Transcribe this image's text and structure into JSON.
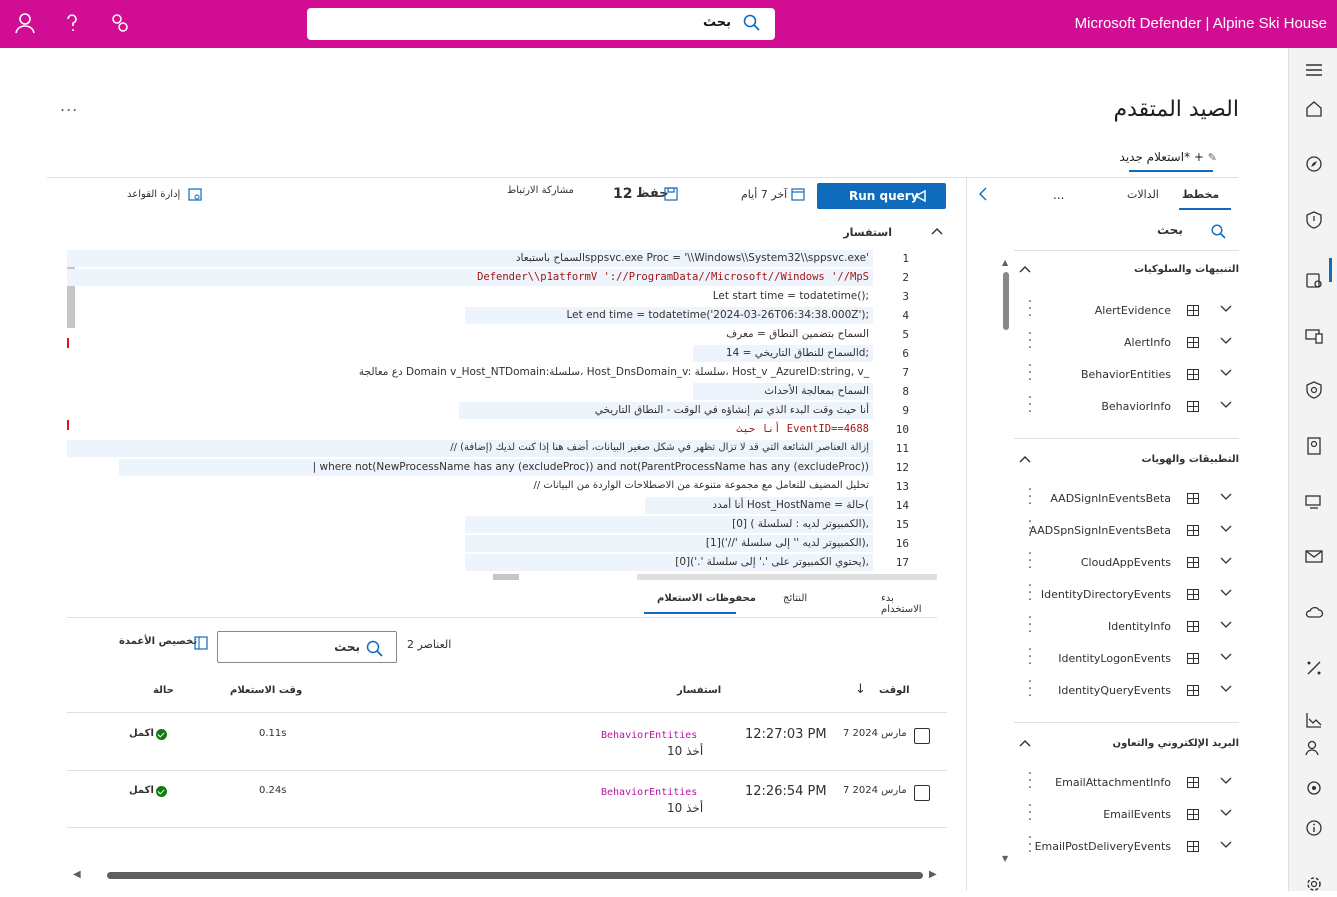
{
  "header": {
    "app_title": "Microsoft Defender | Alpine Ski House",
    "search_placeholder": "بحث"
  },
  "page": {
    "title": "الصيد المتقدم",
    "more": "...",
    "tab_label": "استعلام جديد* +"
  },
  "toolbar": {
    "run_label": "Run query",
    "time_range": "آخر 7 أيام",
    "save_label": "حفظ",
    "save_count": "12",
    "share_label": "مشاركة الارتباط",
    "rules_label": "إدارة القواعد"
  },
  "schema_panel": {
    "tabs": [
      "مخطط",
      "الدالات",
      "..."
    ],
    "search_label": "بحث",
    "groups": [
      {
        "title": "التنبيهات والسلوكيات",
        "tables": [
          "AlertEvidence",
          "AlertInfo",
          "BehaviorEntities",
          "BehaviorInfo"
        ]
      },
      {
        "title": "التطبيقات والهويات",
        "tables": [
          "AADSignInEventsBeta",
          "AADSpnSignInEventsBeta",
          "CloudAppEvents",
          "IdentityDirectoryEvents",
          "IdentityInfo",
          "IdentityLogonEvents",
          "IdentityQueryEvents"
        ]
      },
      {
        "title": "البريد الإلكتروني والتعاون",
        "tables": [
          "EmailAttachmentInfo",
          "EmailEvents",
          "EmailPostDeliveryEvents"
        ]
      }
    ]
  },
  "editor": {
    "label": "استفسار",
    "lines": [
      {
        "n": "1",
        "text": "السماح باستبعادsppsvc.exe Proc = '\\\\Windows\\\\System32\\\\sppsvc.exe'"
      },
      {
        "n": "2",
        "text": "Defender\\\\p1atformV '://ProgramData//Microsoft//Windows '//MpS"
      },
      {
        "n": "3",
        "text": "Let start time = todatetime();"
      },
      {
        "n": "4",
        "text": "Let end time = todatetime('2024-03-26T06:34:38.000Z');"
      },
      {
        "n": "5",
        "text": "السماح بتضمين النطاق = معرف"
      },
      {
        "n": "6",
        "text": "السماح للنطاق التاريخي = 14d;"
      },
      {
        "n": "7",
        "text": "دع معالجة Domain v_Host_NTDomain:سلسلة، Host_DnsDomain_v: سلسلة، Host_v _AzureID:string, v_"
      },
      {
        "n": "8",
        "text": "السماح بمعالجة الأحداث"
      },
      {
        "n": "9",
        "text": "أنا حيث وقت البدء الذي تم إنشاؤه في الوقت - النطاق التاريخي"
      },
      {
        "n": "10",
        "text": "أنا حيث EventID==4688"
      },
      {
        "n": "11",
        "text": "// إزالة العناصر الشائعة التي قد لا تزال تظهر في شكل صغير البيانات، أضف هنا إذا كنت لديك (إضافة)"
      },
      {
        "n": "12",
        "text": "| where not(NewProcessName has any (excludeProc)) and not(ParentProcessName has any (excludeProc))"
      },
      {
        "n": "13",
        "text": "// تحليل المضيف للتعامل مع مجموعة متنوعة من الاصطلاحات الواردة من البيانات"
      },
      {
        "n": "14",
        "text": "أنا أمدد Host_HostName = حالة("
      },
      {
        "n": "15",
        "text": "الكمبيوتر لديه : لسلسلة ) [0]),"
      },
      {
        "n": "16",
        "text": "الكمبيوتر لديه '' إلى سلسلة '//')[1]),"
      },
      {
        "n": "17",
        "text": "يحتوي الكمبيوتر على '.' إلى سلسلة '.')[0]),"
      }
    ]
  },
  "results": {
    "tabs": [
      "بدء الاستخدام",
      "النتائج",
      "محفوظات الاستعلام"
    ],
    "item_count": "2 العناصر",
    "search_placeholder": "بحث",
    "customize_label": "تخصيص الأعمدة",
    "columns": {
      "time": "الوقت",
      "query": "استفسار",
      "duration": "وقت الاستعلام",
      "state": "حالة"
    },
    "rows": [
      {
        "date": "7 مارس 2024",
        "time": "12:27:03 PM",
        "query_table": "BehaviorEntities",
        "query_take": "أخذ 10",
        "duration": "0.11s",
        "state": "اكمل"
      },
      {
        "date": "7 مارس 2024",
        "time": "12:26:54 PM",
        "query_table": "BehaviorEntities",
        "query_take": "أخذ 10",
        "duration": "0.24s",
        "state": "اكمل"
      }
    ]
  },
  "colors": {
    "accent": "#d10e93",
    "primary": "#0f6cbd",
    "success": "#107c10"
  }
}
